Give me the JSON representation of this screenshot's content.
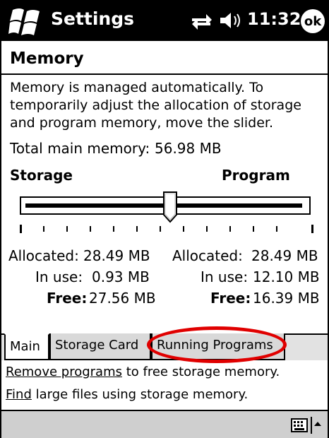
{
  "window": {
    "title": "Settings",
    "clock": "11:32",
    "ok_label": "ok"
  },
  "page": {
    "section_title": "Memory",
    "description": "Memory is managed automatically. To temporarily adjust the allocation of storage and program memory, move the slider.",
    "total_label": "Total main memory:",
    "total_value": "56.98 MB"
  },
  "slider": {
    "left_label": "Storage",
    "right_label": "Program",
    "position_fraction": 0.5
  },
  "storage": {
    "allocated_label": "Allocated:",
    "allocated_value": "28.49 MB",
    "in_use_label": "In use:",
    "in_use_value": "0.93 MB",
    "free_label": "Free:",
    "free_value": "27.56 MB"
  },
  "program": {
    "allocated_label": "Allocated:",
    "allocated_value": "28.49 MB",
    "in_use_label": "In use:",
    "in_use_value": "12.10 MB",
    "free_label": "Free:",
    "free_value": "16.39 MB"
  },
  "tabs": [
    {
      "label": "Main",
      "active": true
    },
    {
      "label": "Storage Card",
      "active": false
    },
    {
      "label": "Running Programs",
      "active": false
    }
  ],
  "links": {
    "remove_link": "Remove programs",
    "remove_rest": " to free storage memory.",
    "find_link": "Find",
    "find_rest": " large files using storage memory."
  },
  "colors": {
    "highlight_oval": "#e00000",
    "titlebar": "#000000"
  },
  "icons": {
    "start": "windows-flag-icon",
    "connectivity": "connectivity-arrows-icon",
    "volume": "speaker-icon",
    "keyboard": "keyboard-icon"
  }
}
